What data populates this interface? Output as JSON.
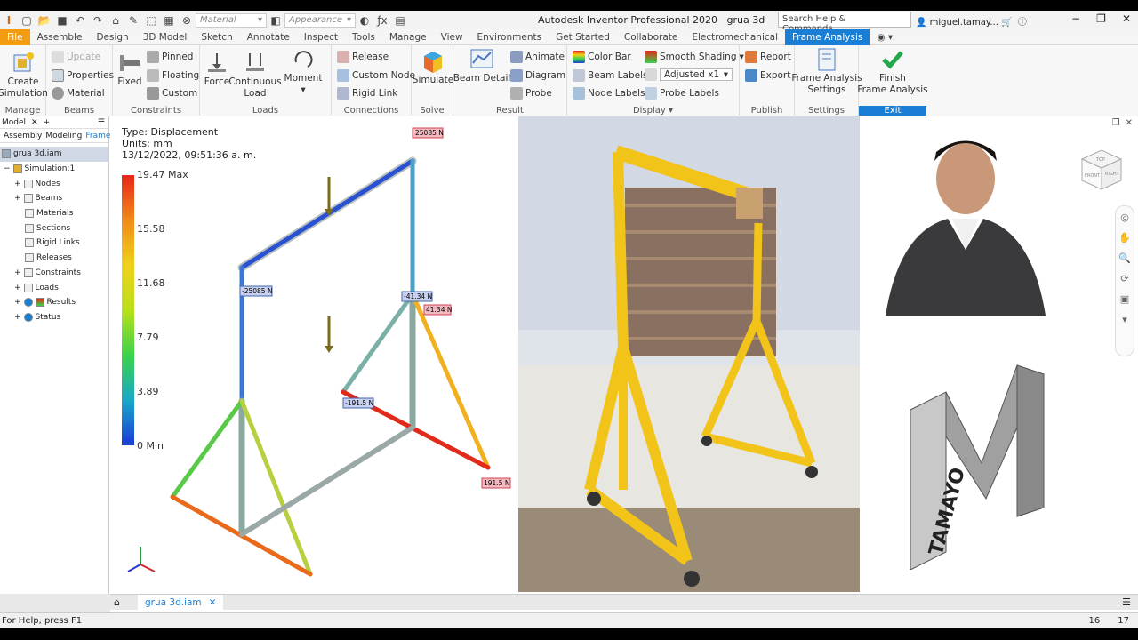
{
  "app": {
    "title": "Autodesk Inventor Professional 2020",
    "doc": "grua 3d",
    "search_placeholder": "Search Help & Commands...",
    "user": "miguel.tamay..."
  },
  "qat": {
    "material_placeholder": "Material",
    "appearance_placeholder": "Appearance"
  },
  "tabs": [
    "File",
    "Assemble",
    "Design",
    "3D Model",
    "Sketch",
    "Annotate",
    "Inspect",
    "Tools",
    "Manage",
    "View",
    "Environments",
    "Get Started",
    "Collaborate",
    "Electromechanical",
    "Frame Analysis"
  ],
  "ribbon": {
    "manage": {
      "label": "Manage",
      "create": "Create",
      "simulation": "Simulation"
    },
    "beams": {
      "label": "Beams",
      "update": "Update",
      "properties": "Properties",
      "material": "Material"
    },
    "constraints": {
      "label": "Constraints",
      "fixed": "Fixed",
      "pinned": "Pinned",
      "floating": "Floating",
      "custom": "Custom"
    },
    "loads": {
      "label": "Loads",
      "force": "Force",
      "continuous": "Continuous",
      "load": "Load",
      "moment": "Moment"
    },
    "connections": {
      "label": "Connections",
      "release": "Release",
      "custom_node": "Custom Node",
      "rigid_link": "Rigid Link"
    },
    "solve": {
      "label": "Solve",
      "simulate": "Simulate"
    },
    "result": {
      "label": "Result",
      "beam_detail": "Beam Detail",
      "animate": "Animate",
      "diagram": "Diagram",
      "probe": "Probe"
    },
    "display": {
      "label": "Display",
      "color_bar": "Color Bar",
      "beam_labels": "Beam Labels",
      "node_labels": "Node Labels",
      "smooth_shading": "Smooth Shading",
      "adjusted": "Adjusted x1",
      "probe_labels": "Probe Labels"
    },
    "publish": {
      "label": "Publish",
      "report": "Report",
      "export": "Export"
    },
    "settings": {
      "label": "Settings",
      "frame_analysis": "Frame Analysis",
      "settings": "Settings"
    },
    "exit": {
      "label": "Exit",
      "finish": "Finish",
      "frame_analysis": "Frame Analysis"
    }
  },
  "browser": {
    "head": "Model",
    "tabs": [
      "Assembly",
      "Modeling",
      "Frame"
    ],
    "tree": [
      "grua 3d.iam",
      "Simulation:1",
      "Nodes",
      "Beams",
      "Materials",
      "Sections",
      "Rigid Links",
      "Releases",
      "Constraints",
      "Loads",
      "Results",
      "Status"
    ]
  },
  "legend": {
    "type": "Type: Displacement",
    "units": "Units: mm",
    "date": "13/12/2022, 09:51:36 a. m.",
    "ticks": [
      "19.47 Max",
      "15.58",
      "11.68",
      "7.79",
      "3.89",
      "0 Min"
    ]
  },
  "labels": {
    "top": "25085 N",
    "left": "-25085 N",
    "mid1": "-41.34 N",
    "mid2": "41.34 N",
    "low1": "-191.5 N",
    "low2": "191.5 N"
  },
  "logo_text": "TAMAYO",
  "viewcube": {
    "top": "TOP",
    "front": "FRONT",
    "right": "RIGHT"
  },
  "doctab": "grua 3d.iam",
  "status": {
    "help": "For Help, press F1",
    "n1": "16",
    "n2": "17"
  },
  "colors": {
    "accent": "#1a7fd4",
    "file": "#f39c12",
    "crane": "#f2c318"
  }
}
